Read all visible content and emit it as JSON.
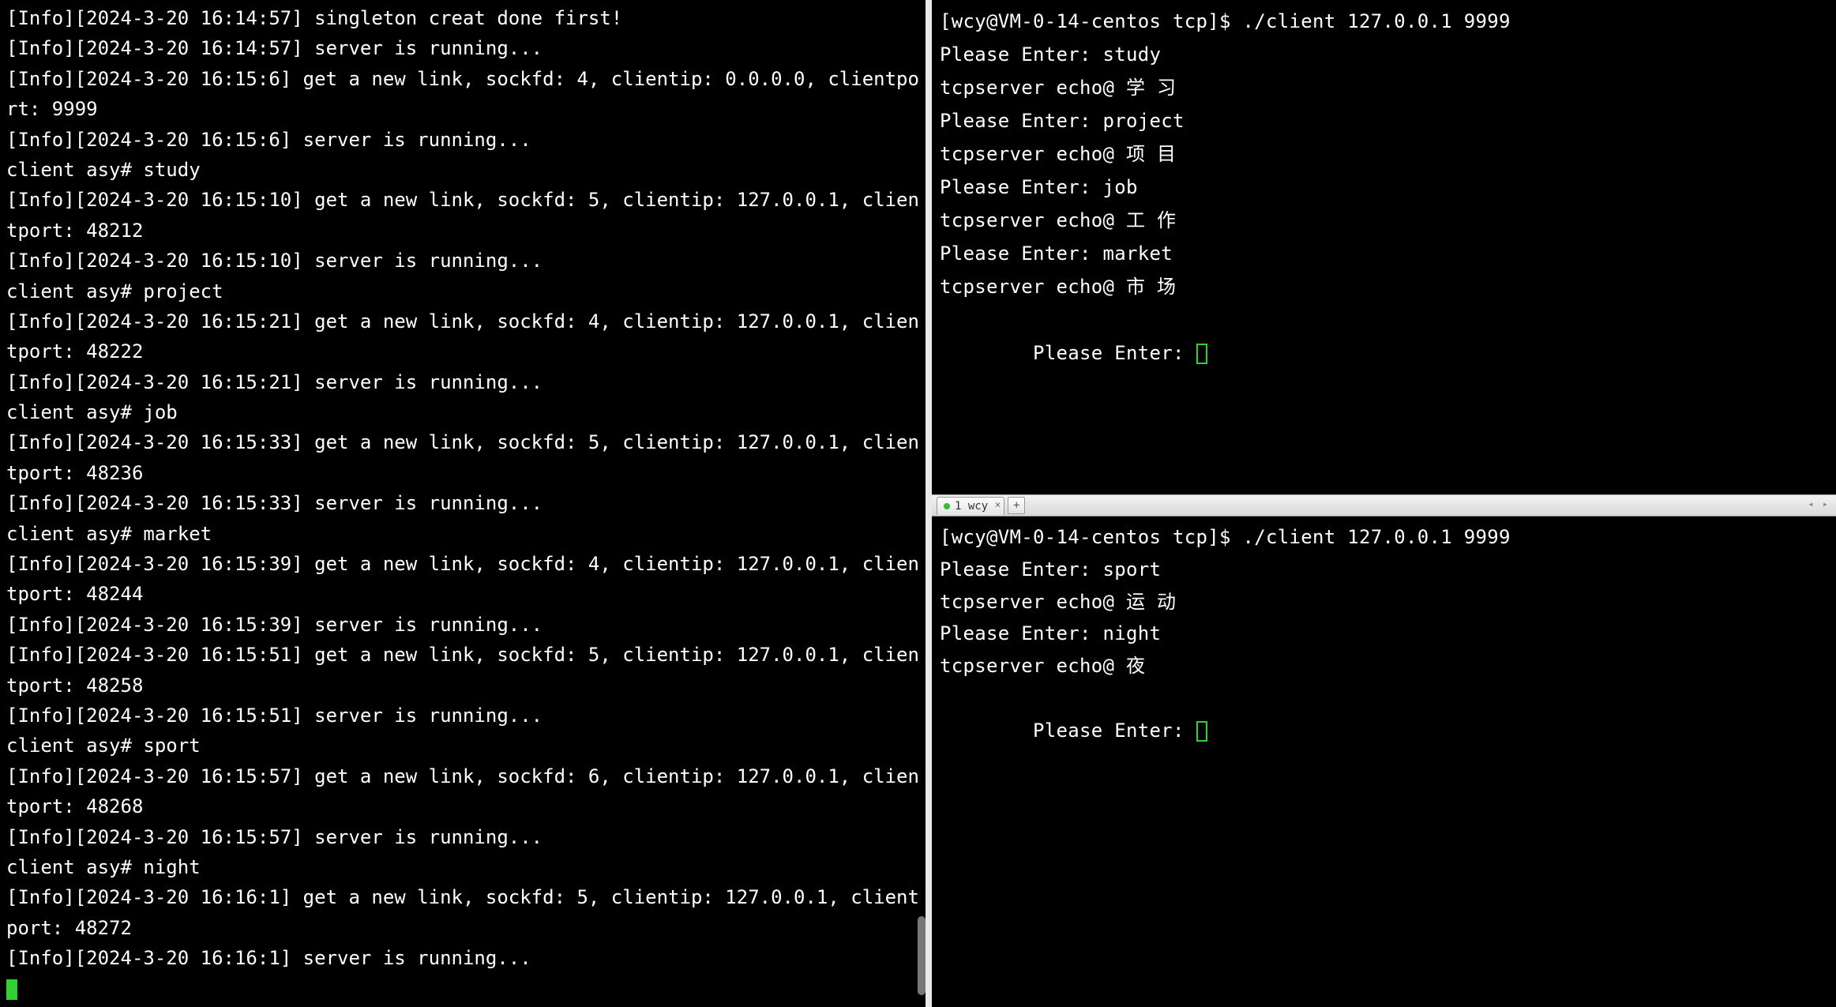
{
  "left_terminal": {
    "lines": [
      "[Info][2024-3-20 16:14:57] singleton creat done first!",
      "[Info][2024-3-20 16:14:57] server is running...",
      "[Info][2024-3-20 16:15:6] get a new link, sockfd: 4, clientip: 0.0.0.0, clientport: 9999",
      "[Info][2024-3-20 16:15:6] server is running...",
      "client asy# study",
      "[Info][2024-3-20 16:15:10] get a new link, sockfd: 5, clientip: 127.0.0.1, clientport: 48212",
      "[Info][2024-3-20 16:15:10] server is running...",
      "client asy# project",
      "[Info][2024-3-20 16:15:21] get a new link, sockfd: 4, clientip: 127.0.0.1, clientport: 48222",
      "[Info][2024-3-20 16:15:21] server is running...",
      "client asy# job",
      "[Info][2024-3-20 16:15:33] get a new link, sockfd: 5, clientip: 127.0.0.1, clientport: 48236",
      "[Info][2024-3-20 16:15:33] server is running...",
      "client asy# market",
      "[Info][2024-3-20 16:15:39] get a new link, sockfd: 4, clientip: 127.0.0.1, clientport: 48244",
      "[Info][2024-3-20 16:15:39] server is running...",
      "[Info][2024-3-20 16:15:51] get a new link, sockfd: 5, clientip: 127.0.0.1, clientport: 48258",
      "[Info][2024-3-20 16:15:51] server is running...",
      "client asy# sport",
      "[Info][2024-3-20 16:15:57] get a new link, sockfd: 6, clientip: 127.0.0.1, clientport: 48268",
      "[Info][2024-3-20 16:15:57] server is running...",
      "client asy# night",
      "[Info][2024-3-20 16:16:1] get a new link, sockfd: 5, clientip: 127.0.0.1, clientport: 48272",
      "[Info][2024-3-20 16:16:1] server is running..."
    ]
  },
  "right_top_terminal": {
    "prompt_line": "[wcy@VM-0-14-centos tcp]$ ./client 127.0.0.1 9999",
    "exchanges": [
      {
        "prompt": "Please Enter: study",
        "echo": "tcpserver echo@ 学 习"
      },
      {
        "prompt": "Please Enter: project",
        "echo": "tcpserver echo@ 项 目"
      },
      {
        "prompt": "Please Enter: job",
        "echo": "tcpserver echo@ 工 作"
      },
      {
        "prompt": "Please Enter: market",
        "echo": "tcpserver echo@ 市 场"
      }
    ],
    "waiting_prompt": "Please Enter: "
  },
  "tabbar": {
    "tab_label": "1 wcy",
    "add_label": "+",
    "arrows": "◂ ▸"
  },
  "right_bottom_terminal": {
    "prompt_line": "[wcy@VM-0-14-centos tcp]$ ./client 127.0.0.1 9999",
    "exchanges": [
      {
        "prompt": "Please Enter: sport",
        "echo": "tcpserver echo@ 运 动"
      },
      {
        "prompt": "Please Enter: night",
        "echo": "tcpserver echo@ 夜"
      }
    ],
    "waiting_prompt": "Please Enter: "
  }
}
